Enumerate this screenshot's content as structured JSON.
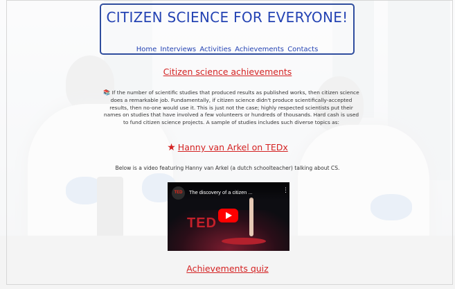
{
  "site": {
    "title": "CITIZEN SCIENCE FOR EVERYONE!",
    "nav": [
      "Home",
      "Interviews",
      "Activities",
      "Achievements",
      "Contacts"
    ]
  },
  "main": {
    "heading": "Citizen science achievements",
    "intro_icon": "books-icon",
    "intro": "If the number of scientific studies that produced results as published works, then citizen science does a remarkable job. Fundamentally, if citizen science didn't produce scientifically-accepted results, then no-one would use it. This is just not the case; highly respected scientists put their names on studies that have involved a few volunteers or hundreds of thousands. Hard cash is used to fund citizen science projects. A sample of studies includes such diverse topics as:",
    "ted_heading": "Hanny van Arkel on TEDx",
    "ted_icon": "star-icon",
    "video_caption": "Below is a video featuring Hanny van Arkel (a dutch schoolteacher) talking about CS.",
    "video": {
      "channel_logo": "TED",
      "title": "The discovery of a citizen ...",
      "stage_text": "TED"
    },
    "quiz_heading": "Achievements quiz"
  },
  "colors": {
    "brand_blue": "#2443b3",
    "accent_red": "#d42222",
    "play_red": "#ff0000"
  }
}
